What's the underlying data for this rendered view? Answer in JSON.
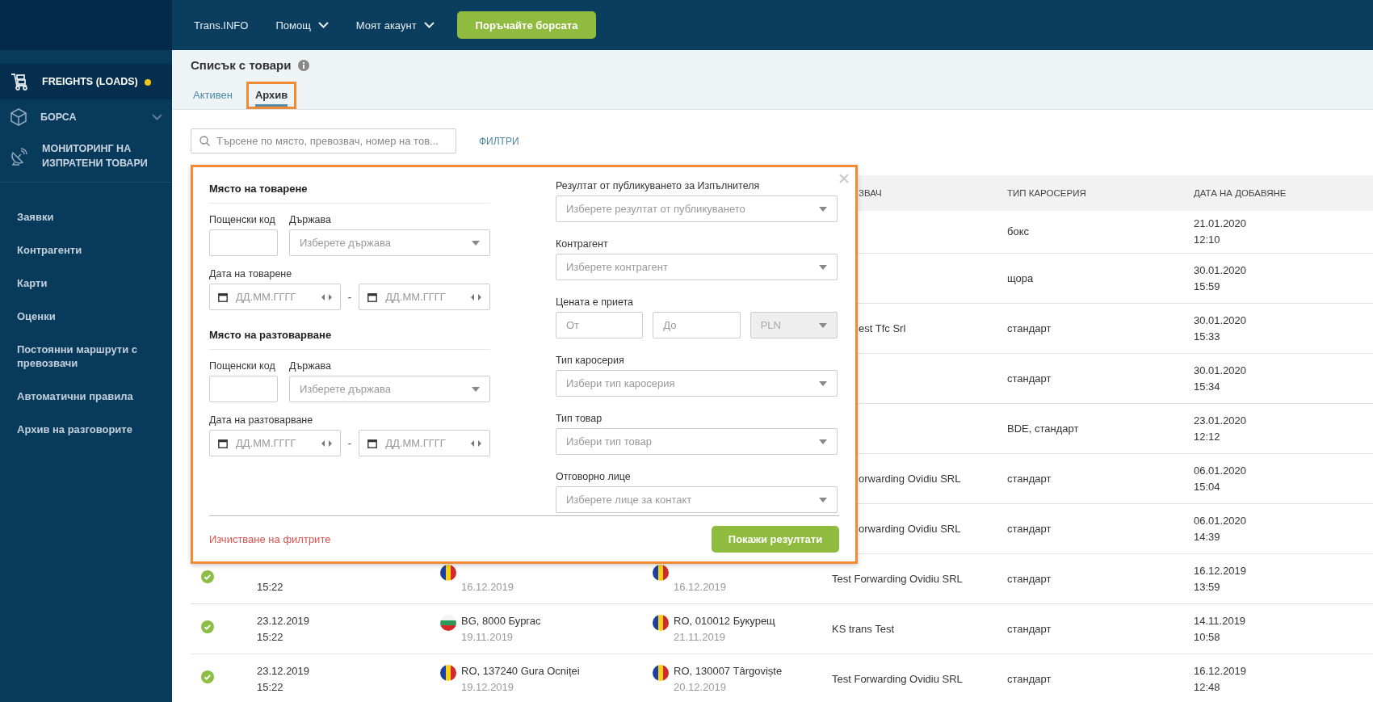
{
  "top_nav": {
    "items": [
      {
        "label": "Trans.INFO",
        "dropdown": false
      },
      {
        "label": "Помощ",
        "dropdown": true
      },
      {
        "label": "Моят акаунт",
        "dropdown": true
      }
    ],
    "cta": "Поръчайте борсата"
  },
  "sidebar": {
    "sections": [
      {
        "kind": "freights",
        "label": "FREIGHTS (LOADS)",
        "selected": true,
        "notification": true,
        "expandable": false
      },
      {
        "kind": "exchange",
        "label": "БОРСА",
        "selected": false,
        "notification": false,
        "expandable": true
      },
      {
        "kind": "monitoring",
        "label": "МОНИТОРИНГ НА ИЗПРАТЕНИ ТОВАРИ",
        "selected": false,
        "notification": false,
        "expandable": false
      }
    ],
    "links": [
      "Заявки",
      "Контрагенти",
      "Карти",
      "Оценки",
      "Постоянни маршрути с превозвачи",
      "Автоматични правила",
      "Архив на разговорите"
    ]
  },
  "page": {
    "title": "Списък с товари",
    "tabs": [
      {
        "label": "Активен",
        "selected": false,
        "highlighted": false
      },
      {
        "label": "Архив",
        "selected": true,
        "highlighted": true
      }
    ],
    "search": {
      "placeholder": "Търсене по място, превозвач, номер на тов..."
    },
    "filters_link": "ФИЛТРИ"
  },
  "filter_panel": {
    "highlighted": true,
    "left": [
      {
        "title": "Място на товарене",
        "postal_label": "Пощенски код",
        "country_label": "Държава",
        "country_placeholder": "Изберете държава",
        "date_label": "Дата на товарене",
        "date_from": "ДД.ММ.ГГГГ",
        "separator": "-",
        "date_to": "ДД.ММ.ГГГГ"
      },
      {
        "title": "Място на разтоварване",
        "postal_label": "Пощенски код",
        "country_label": "Държава",
        "country_placeholder": "Изберете държава",
        "date_label": "Дата на разтоварване",
        "date_from": "ДД.ММ.ГГГГ",
        "separator": "-",
        "date_to": "ДД.ММ.ГГГГ"
      }
    ],
    "right": [
      {
        "kind": "select",
        "label": "Резултат от публикуването за Изпълнителя",
        "placeholder": "Изберете резултат от публикуването"
      },
      {
        "kind": "select",
        "label": "Контрагент",
        "placeholder": "Изберете контрагент"
      },
      {
        "kind": "price",
        "label": "Цената е приета",
        "from_placeholder": "От",
        "to_placeholder": "До",
        "currency": "PLN",
        "currency_disabled": true
      },
      {
        "kind": "select",
        "label": "Тип каросерия",
        "placeholder": "Избери тип каросерия"
      },
      {
        "kind": "select",
        "label": "Тип товар",
        "placeholder": "Избери тип товар"
      },
      {
        "kind": "select",
        "label": "Отговорно лице",
        "placeholder": "Изберете лице за контакт"
      }
    ],
    "clear_link": "Изчистване на филтрите",
    "submit": "Покажи резултати"
  },
  "table": {
    "visible_columns": [
      "ЗВАЧ",
      "ТИП КАРОСЕРИЯ",
      "ДАТА НА ДОБАВЯНЕ"
    ],
    "rows": [
      {
        "kind": "covered",
        "body_type": "бокс",
        "added_date": "21.01.2020",
        "added_time": "12:10"
      },
      {
        "kind": "covered",
        "body_type": "щора",
        "added_date": "30.01.2020",
        "added_time": "15:59"
      },
      {
        "kind": "covered",
        "carrier": "est Tfc Srl",
        "body_type": "стандарт",
        "added_date": "30.01.2020",
        "added_time": "15:33"
      },
      {
        "kind": "covered",
        "body_type": "стандарт",
        "added_date": "30.01.2020",
        "added_time": "15:34"
      },
      {
        "kind": "covered",
        "body_type": "BDE, стандарт",
        "added_date": "23.01.2020",
        "added_time": "12:12"
      },
      {
        "kind": "covered",
        "carrier": "orwarding Ovidiu SRL",
        "body_type": "стандарт",
        "added_date": "06.01.2020",
        "added_time": "15:04"
      },
      {
        "kind": "covered",
        "carrier": "orwarding Ovidiu SRL",
        "body_type": "стандарт",
        "added_date": "06.01.2020",
        "added_time": "14:39"
      },
      {
        "kind": "partly",
        "completed": true,
        "created_time": "15:22",
        "loading": {
          "kind": "ro",
          "date": "16.12.2019"
        },
        "unloading": {
          "kind": "ro",
          "date": "16.12.2019"
        },
        "carrier": "Test Forwarding Ovidiu SRL",
        "body_type": "стандарт",
        "added_date": "16.12.2019",
        "added_time": "13:59"
      },
      {
        "kind": "full",
        "completed": true,
        "created_date": "23.12.2019",
        "created_time": "15:22",
        "loading": {
          "kind": "bg",
          "place": "BG, 8000 Бургас",
          "date": "19.11.2019"
        },
        "unloading": {
          "kind": "ro",
          "place": "RO, 010012 Букурещ",
          "date": "21.11.2019"
        },
        "carrier": "KS trans Test",
        "body_type": "стандарт",
        "added_date": "14.11.2019",
        "added_time": "10:58"
      },
      {
        "kind": "full",
        "completed": true,
        "created_date": "23.12.2019",
        "created_time": "15:22",
        "loading": {
          "kind": "ro",
          "place": "RO, 137240 Gura Ocniței",
          "date": "19.12.2019"
        },
        "unloading": {
          "kind": "ro",
          "place": "RO, 130007 Târgoviște",
          "date": "20.12.2019"
        },
        "carrier": "Test Forwarding Ovidiu SRL",
        "body_type": "стандарт",
        "added_date": "16.12.2019",
        "added_time": "12:48"
      }
    ]
  }
}
